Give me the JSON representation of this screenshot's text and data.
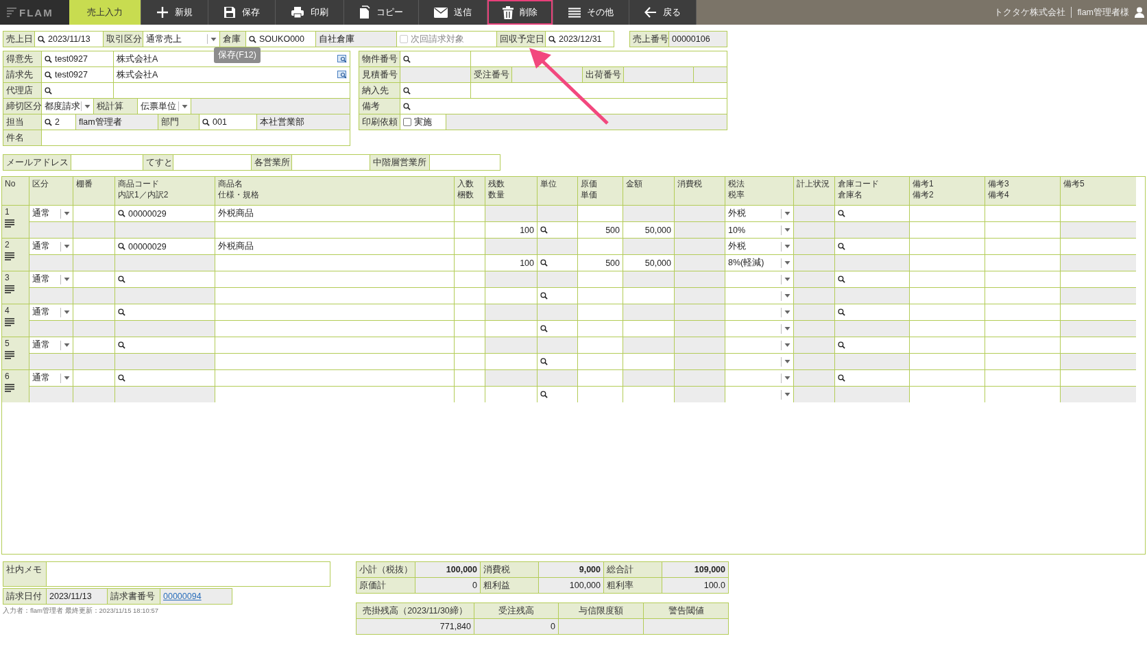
{
  "toolbar": {
    "logo": "FLAM",
    "items": [
      {
        "label": "売上入力",
        "selected": true,
        "highlighted": false
      },
      {
        "label": "新規",
        "selected": false,
        "highlighted": false
      },
      {
        "label": "保存",
        "selected": false,
        "highlighted": false
      },
      {
        "label": "印刷",
        "selected": false,
        "highlighted": false
      },
      {
        "label": "コピー",
        "selected": false,
        "highlighted": false
      },
      {
        "label": "送信",
        "selected": false,
        "highlighted": false
      },
      {
        "label": "削除",
        "selected": false,
        "highlighted": true
      },
      {
        "label": "その他",
        "selected": false,
        "highlighted": false
      },
      {
        "label": "戻る",
        "selected": false,
        "highlighted": false
      }
    ],
    "company": "トクタケ株式会社",
    "user": "flam管理者様"
  },
  "tooltip": {
    "text": "保存(F12)"
  },
  "header": {
    "sales_date": {
      "label": "売上日",
      "value": "2023/11/13"
    },
    "deal_type": {
      "label": "取引区分",
      "value": "通常売上"
    },
    "warehouse": {
      "label": "倉庫",
      "code": "SOUKO000",
      "name": "自社倉庫"
    },
    "next_billing": {
      "label": "次回請求対象",
      "checked": false,
      "disabled": true
    },
    "collection_date": {
      "label": "回収予定日",
      "value": "2023/12/31"
    },
    "sales_no": {
      "label": "売上番号",
      "value": "00000106"
    }
  },
  "customer": {
    "customer": {
      "label": "得意先",
      "code": "test0927",
      "name": "株式会社A"
    },
    "billing": {
      "label": "請求先",
      "code": "test0927",
      "name": "株式会社A"
    },
    "agent": {
      "label": "代理店"
    },
    "closing": {
      "label": "締切区分",
      "value": "都度請求"
    },
    "tax_calc": {
      "label": "税計算",
      "value": "伝票単位"
    },
    "staff": {
      "label": "担当",
      "code": "2",
      "name": "flam管理者"
    },
    "dept": {
      "label": "部門",
      "code": "001",
      "name": "本社営業部"
    },
    "subject": {
      "label": "件名"
    }
  },
  "details": {
    "property_no": {
      "label": "物件番号"
    },
    "estimate_no": {
      "label": "見積番号"
    },
    "order_no": {
      "label": "受注番号"
    },
    "shipping_no": {
      "label": "出荷番号"
    },
    "delivery": {
      "label": "納入先"
    },
    "note": {
      "label": "備考"
    },
    "print_request": {
      "label": "印刷依頼",
      "option": "実施",
      "checked": false
    }
  },
  "extra_fields": [
    {
      "label": "メールアドレス"
    },
    {
      "label": "てすと"
    },
    {
      "label": "各営業所"
    },
    {
      "label": "中階層営業所"
    }
  ],
  "table": {
    "columns": [
      {
        "line1": "No"
      },
      {
        "line1": "区分"
      },
      {
        "line1": "棚番"
      },
      {
        "line1": "商品コード",
        "line2": "内訳1／内訳2"
      },
      {
        "line1": "商品名",
        "line2": "仕様・規格"
      },
      {
        "line1": "入数",
        "line2": "梱数"
      },
      {
        "line1": "残数",
        "line2": "数量"
      },
      {
        "line1": "単位"
      },
      {
        "line1": "原価",
        "line2": "単価"
      },
      {
        "line1": "金額"
      },
      {
        "line1": "消費税"
      },
      {
        "line1": "税法",
        "line2": "税率"
      },
      {
        "line1": "計上状況"
      },
      {
        "line1": "倉庫コード",
        "line2": "倉庫名"
      },
      {
        "line1": "備考1",
        "line2": "備考2"
      },
      {
        "line1": "備考3",
        "line2": "備考4"
      },
      {
        "line1": "備考5"
      }
    ],
    "rows": [
      {
        "no": "1",
        "category": "通常",
        "product_code": "00000029",
        "product_name": "外税商品",
        "quantity": "100",
        "unit_price": "500",
        "amount": "50,000",
        "tax_method": "外税",
        "tax_rate": "10%"
      },
      {
        "no": "2",
        "category": "通常",
        "product_code": "00000029",
        "product_name": "外税商品",
        "quantity": "100",
        "unit_price": "500",
        "amount": "50,000",
        "tax_method": "外税",
        "tax_rate": "8%(軽減)"
      },
      {
        "no": "3",
        "category": "通常"
      },
      {
        "no": "4",
        "category": "通常"
      },
      {
        "no": "5",
        "category": "通常"
      },
      {
        "no": "6",
        "category": "通常"
      }
    ]
  },
  "memo": {
    "label": "社内メモ"
  },
  "invoice": {
    "date_label": "請求日付",
    "date": "2023/11/13",
    "number_label": "請求書番号",
    "number": "00000094"
  },
  "footer_note": "入力者：flam管理者 最終更新：2023/11/15 18:10:57",
  "totals": {
    "rows": [
      {
        "emphasis": true,
        "cells": [
          {
            "label": "小計（税抜）",
            "value": "100,000"
          },
          {
            "label": "消費税",
            "value": "9,000"
          },
          {
            "label": "総合計",
            "value": "109,000"
          }
        ]
      },
      {
        "emphasis": false,
        "cells": [
          {
            "label": "原価計",
            "value": "0"
          },
          {
            "label": "粗利益",
            "value": "100,000"
          },
          {
            "label": "粗利率",
            "value": "100.0"
          }
        ]
      }
    ]
  },
  "balance": {
    "columns": [
      "売掛残高（2023/11/30締）",
      "受注残高",
      "与信限度額",
      "警告閾値"
    ],
    "values": [
      "771,840",
      "0"
    ]
  }
}
